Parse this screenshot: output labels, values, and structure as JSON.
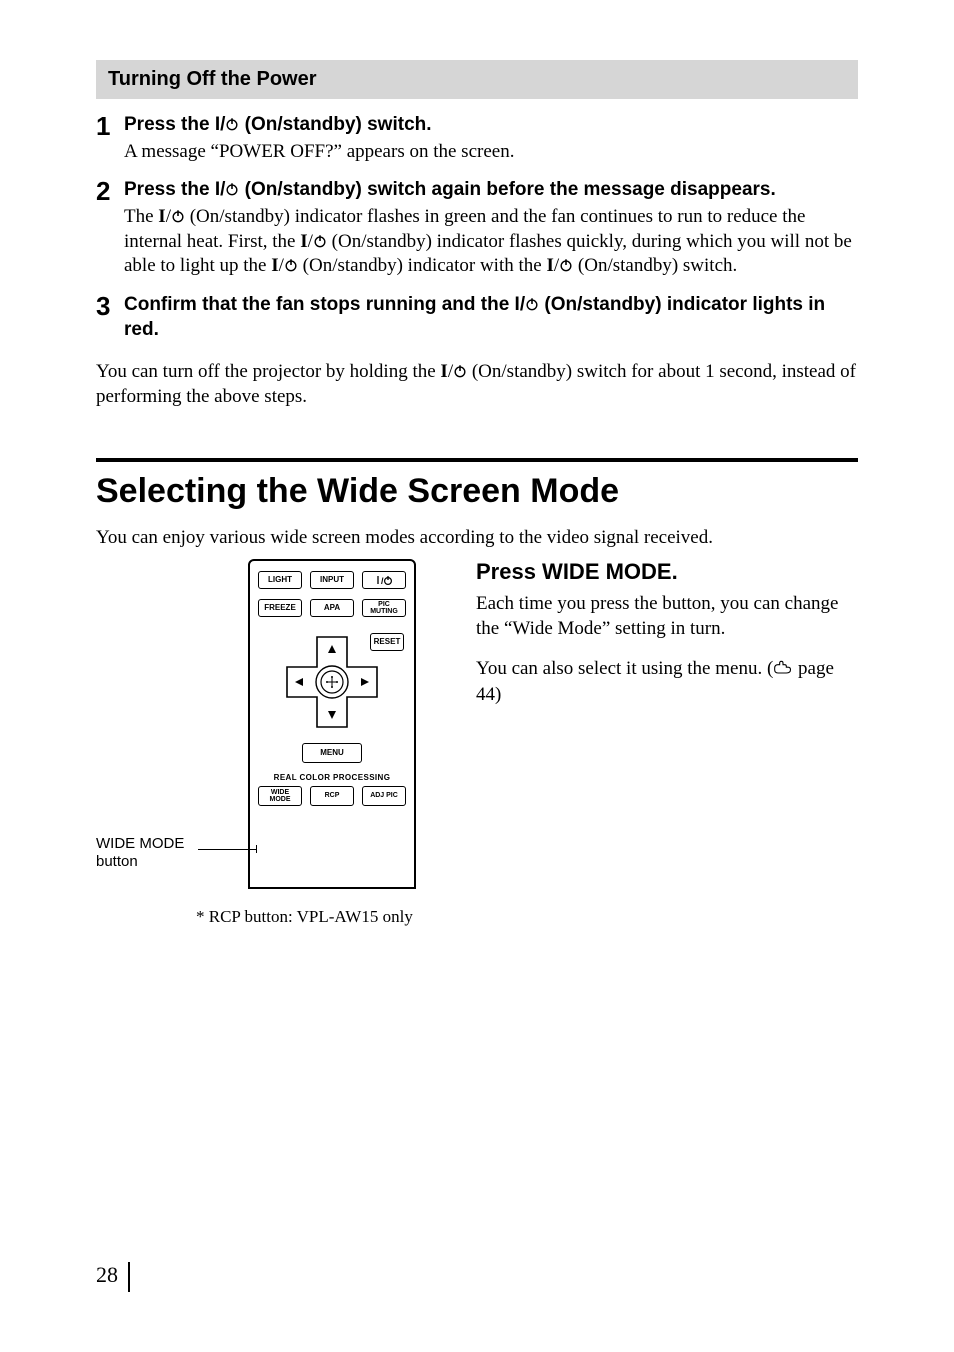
{
  "sectionBar": "Turning Off the Power",
  "steps": [
    {
      "num": "1",
      "title_pre": "Press the ",
      "title_bold": "I",
      "title_post": " (On/standby) switch.",
      "desc": "A message “POWER OFF?” appears on the screen."
    },
    {
      "num": "2",
      "title_pre": "Press the ",
      "title_bold": "I",
      "title_post": " (On/standby) switch again before the message disappears.",
      "desc_parts": {
        "a": "The ",
        "b": " (On/standby) indicator flashes in green and the fan continues to run to reduce the internal heat. First, the ",
        "c": " (On/standby) indicator flashes quickly, during which you will not be able to light up the ",
        "d": " (On/standby) indicator with the ",
        "e": " (On/standby) switch."
      }
    },
    {
      "num": "3",
      "title_pre": "Confirm that the fan stops running and the ",
      "title_bold": "I",
      "title_post": " (On/standby) indicator lights in red.",
      "desc": ""
    }
  ],
  "postPara_pre": "You can turn off the projector by holding the ",
  "postPara_post": " (On/standby) switch for about 1 second, instead of performing the above steps.",
  "mainHeading": "Selecting the Wide Screen Mode",
  "intro": "You can enjoy various wide screen modes according to the video signal received.",
  "rightHeading": "Press WIDE MODE.",
  "rightPara1": "Each time you press the button, you can change the “Wide Mode” setting in turn.",
  "rightPara2_pre": "You can also select it using the menu. (",
  "rightPara2_post": " page 44)",
  "callout_line1": "WIDE MODE",
  "callout_line2": "button",
  "footnote": "* RCP button: VPL-AW15 only",
  "pageNumber": "28",
  "remote": {
    "row1": [
      "LIGHT",
      "INPUT",
      ""
    ],
    "row2": [
      "FREEZE",
      "APA",
      "PIC\nMUTING"
    ],
    "reset": "RESET",
    "menu": "MENU",
    "rcpLabel": "REAL COLOR PROCESSING",
    "row3": [
      "WIDE\nMODE",
      "RCP",
      "ADJ PIC"
    ]
  }
}
